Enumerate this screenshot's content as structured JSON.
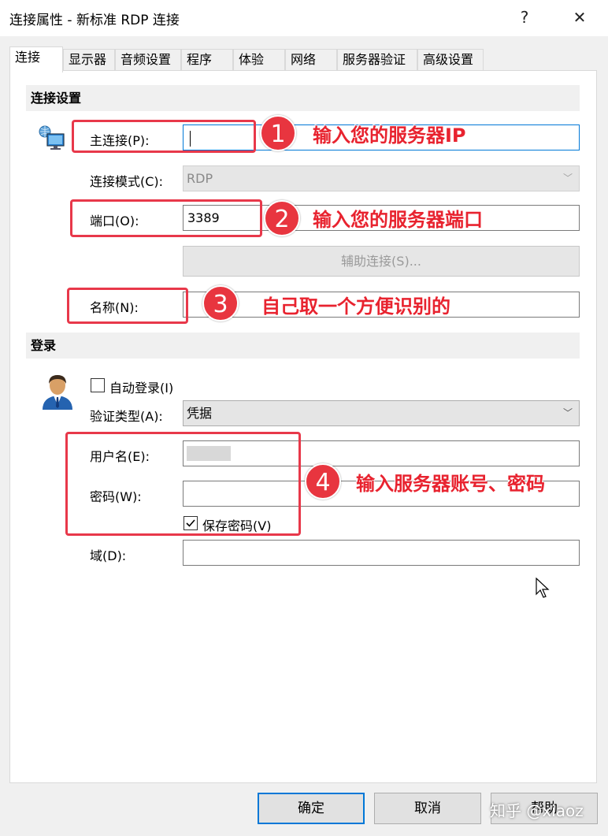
{
  "window": {
    "title": "连接属性 - 新标准 RDP 连接",
    "help_glyph": "?",
    "close_glyph": "✕"
  },
  "tabs": [
    {
      "label": "连接",
      "active": true
    },
    {
      "label": "显示器",
      "active": false
    },
    {
      "label": "音频设置",
      "active": false
    },
    {
      "label": "程序",
      "active": false
    },
    {
      "label": "体验",
      "active": false
    },
    {
      "label": "网络",
      "active": false
    },
    {
      "label": "服务器验证",
      "active": false
    },
    {
      "label": "高级设置",
      "active": false
    }
  ],
  "connection_section": {
    "header": "连接设置",
    "host_label": "主连接(P):",
    "host_value": "",
    "mode_label": "连接模式(C):",
    "mode_value": "RDP",
    "port_label": "端口(O):",
    "port_value": "3389",
    "assist_button": "辅助连接(S)...",
    "name_label": "名称(N):",
    "name_value": ""
  },
  "login_section": {
    "header": "登录",
    "auto_login_label": "自动登录(I)",
    "auto_login_checked": false,
    "auth_type_label": "验证类型(A):",
    "auth_type_value": "凭据",
    "username_label": "用户名(E):",
    "password_label": "密码(W):",
    "save_password_label": "保存密码(V)",
    "save_password_checked": true,
    "domain_label": "域(D):",
    "domain_value": ""
  },
  "annotations": [
    {
      "number": "1",
      "text": "输入您的服务器IP"
    },
    {
      "number": "2",
      "text": "输入您的服务器端口"
    },
    {
      "number": "3",
      "text": "自己取一个方便识别的"
    },
    {
      "number": "4",
      "text": "输入服务器账号、密码"
    }
  ],
  "footer": {
    "ok": "确定",
    "cancel": "取消",
    "help": "帮助"
  },
  "watermark": "知乎 @xiaoz",
  "colors": {
    "annotation_red": "#e8384a",
    "focus_blue": "#0078d7"
  }
}
